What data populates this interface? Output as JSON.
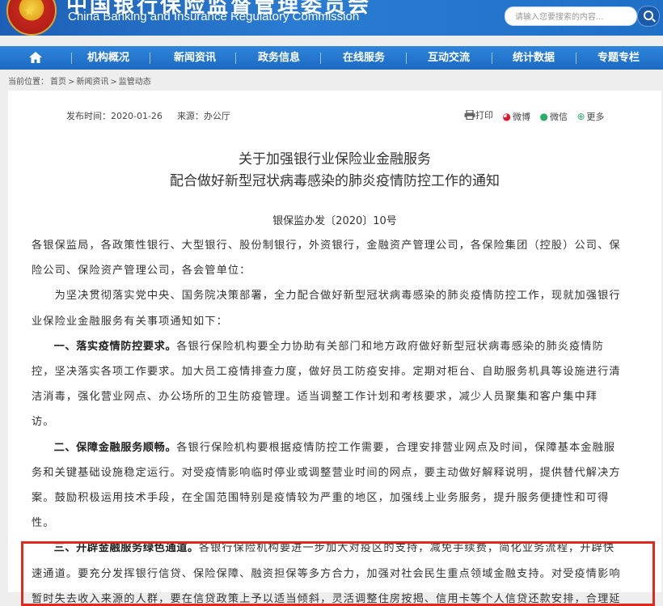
{
  "header": {
    "cn_title": "中国银行保险监督管理委员会",
    "en_title": "China Banking and Insurance Regulatory Commission",
    "search_placeholder": "请输入您要搜索的内容..."
  },
  "nav": {
    "items": [
      "机构概况",
      "新闻资讯",
      "政务信息",
      "在线服务",
      "互动交流",
      "统计数据",
      "专题专栏"
    ]
  },
  "breadcrumb": {
    "label": "当前位置：",
    "items": [
      "首页",
      "新闻资讯",
      "监管动态"
    ],
    "separator": ">"
  },
  "meta": {
    "date_label": "发布时间：",
    "date": "2020-01-26",
    "source_label": "来源：",
    "source": "办公厅"
  },
  "share": {
    "print": "打印",
    "weibo": "微博",
    "weixin": "微信",
    "more": "更多"
  },
  "article": {
    "title_line1": "关于加强银行业保险业金融服务",
    "title_line2": "配合做好新型冠状病毒感染的肺炎疫情防控工作的通知",
    "doc_number": "银保监办发〔2020〕10号",
    "lines": [
      {
        "text": "各银保监局，各政策性银行、大型银行、股份制银行，外资银行，金融资产管理公司，各保险集团（控股）公司、保"
      },
      {
        "text": "险公司、保险资产管理公司，各会管单位："
      },
      {
        "text": "　　为坚决贯彻落实党中央、国务院决策部署，全力配合做好新型冠状病毒感染的肺炎疫情防控工作，现就加强银行"
      },
      {
        "text": "业保险业金融服务有关事项通知如下："
      },
      {
        "bold": "　　一、落实疫情防控要求。",
        "text": "各银行保险机构要全力协助有关部门和地方政府做好新型冠状病毒感染的肺炎疫情防"
      },
      {
        "text": "控，坚决落实各项工作要求。加大员工疫情排查力度，做好员工防疫安排。定期对柜台、自助服务机具等设施进行清"
      },
      {
        "text": "洁消毒，强化营业网点、办公场所的卫生防疫管理。适当调整工作计划和考核要求，减少人员聚集和客户集中拜"
      },
      {
        "text": "访。"
      },
      {
        "bold": "　　二、保障金融服务顺畅。",
        "text": "各银行保险机构要根据疫情防控工作需要，合理安排营业网点及时间，保障基本金融服"
      },
      {
        "text": "务和关键基础设施稳定运行。对受疫情影响临时停业或调整营业时间的网点，要主动做好解释说明，提供替代解决方"
      },
      {
        "text": "案。鼓励积极运用技术手段，在全国范围特别是疫情较为严重的地区，加强线上业务服务，提升服务便捷性和可得"
      },
      {
        "text": "性。"
      },
      {
        "bold": "　　三、开辟金融服务绿色通道。",
        "text": "各银行保险机构要进一步加大对疫区的支持，减免手续费，简化业务流程，开辟快"
      },
      {
        "text": "速通道。要充分发挥银行信贷、保险保障、融资担保等多方合力，加强对社会民生重点领域金融支持。对受疫情影响"
      },
      {
        "text": "暂时失去收入来源的人群，要在信贷政策上予以适当倾斜，灵活调整住房按揭、信用卡等个人信贷还款安排，合理延"
      }
    ]
  },
  "colors": {
    "header_blue": "#1f6fc7",
    "nav_blue": "#2a7cd2",
    "highlight_red": "#e0291f"
  }
}
